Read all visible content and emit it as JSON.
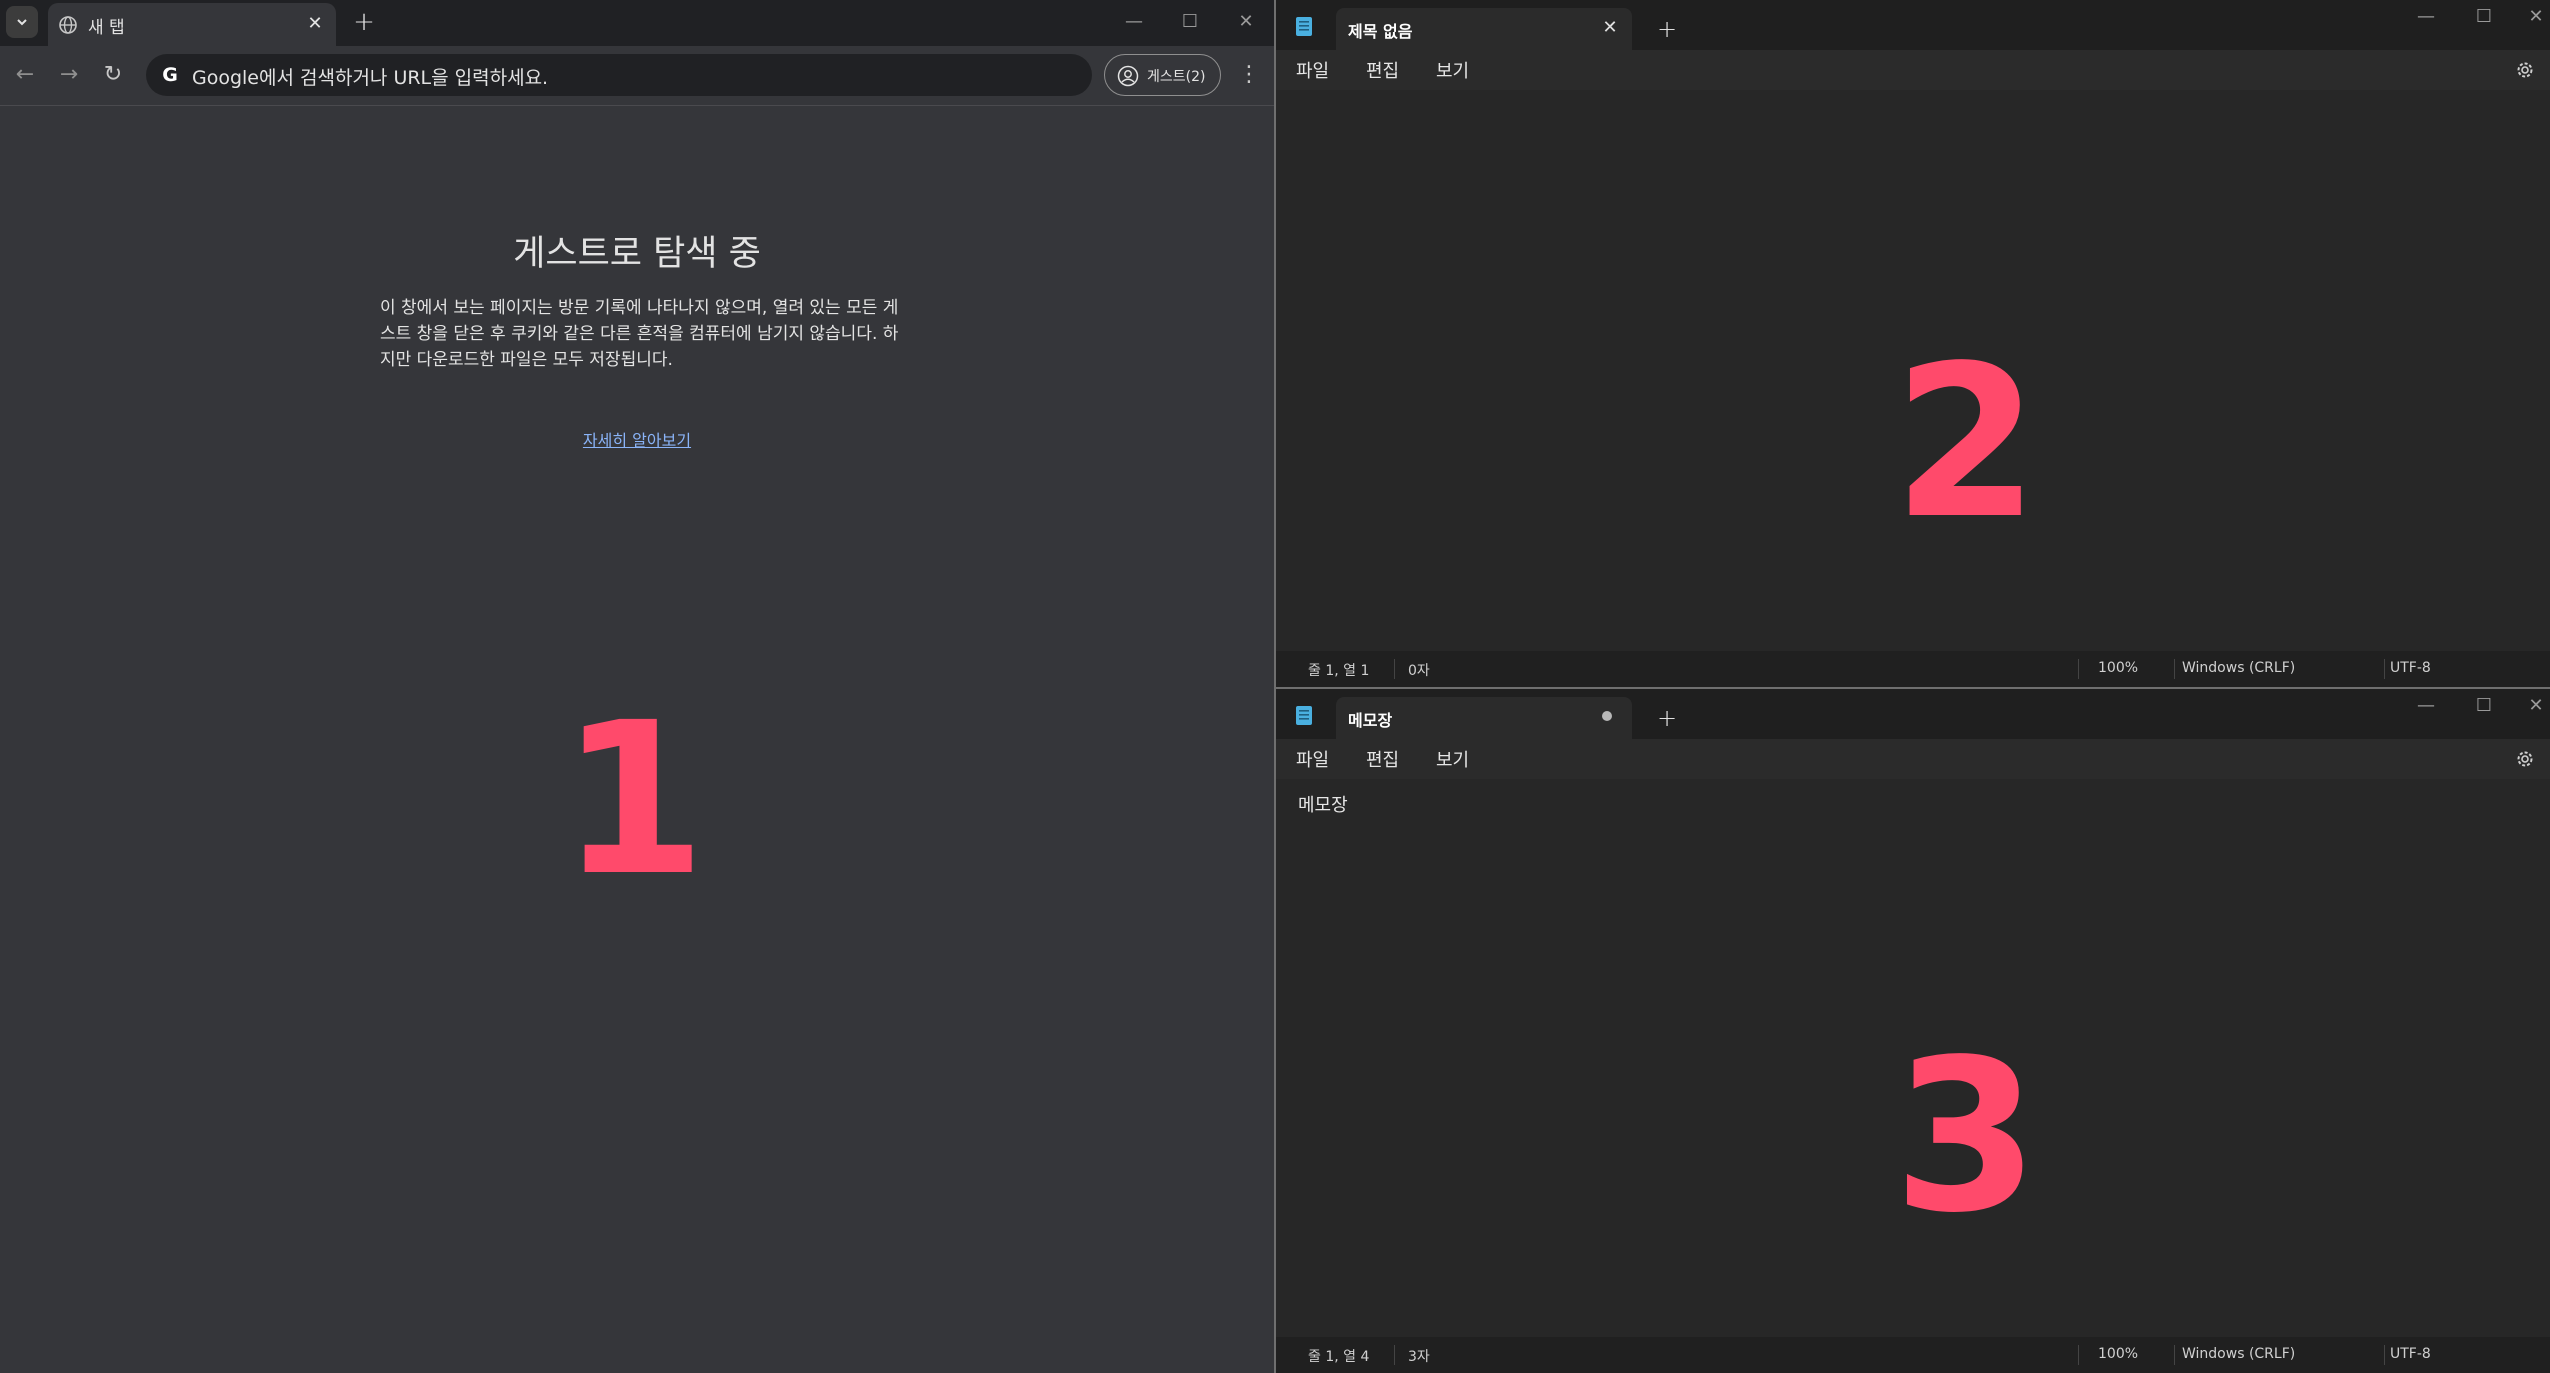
{
  "chrome": {
    "tab_title": "새 탭",
    "omnibox_placeholder": "Google에서 검색하거나 URL을 입력하세요.",
    "profile_label": "게스트(2)",
    "guest_title": "게스트로 탐색 중",
    "guest_description": "이 창에서 보는 페이지는 방문 기록에 나타나지 않으며, 열려 있는 모든 게스트 창을 닫은 후 쿠키와 같은 다른 흔적을 컴퓨터에 남기지 않습니다. 하지만 다운로드한 파일은 모두 저장됩니다.",
    "learn_more": "자세히 알아보기",
    "window_label": "1"
  },
  "notepad_top": {
    "tab_title": "제목 없음",
    "menu": [
      "파일",
      "편집",
      "보기"
    ],
    "editor_text": "",
    "status": {
      "position": "줄 1, 열 1",
      "chars": "0자",
      "zoom": "100%",
      "line_ending": "Windows (CRLF)",
      "encoding": "UTF-8"
    },
    "window_label": "2"
  },
  "notepad_bottom": {
    "tab_title": "메모장",
    "menu": [
      "파일",
      "편집",
      "보기"
    ],
    "editor_text": "메모장",
    "status": {
      "position": "줄 1, 열 4",
      "chars": "3자",
      "zoom": "100%",
      "line_ending": "Windows (CRLF)",
      "encoding": "UTF-8"
    },
    "window_label": "3"
  },
  "colors": {
    "accent_number": "#ff4a6b",
    "link": "#8ab4f8",
    "chrome_bg": "#35363a",
    "notepad_bg": "#272727"
  }
}
